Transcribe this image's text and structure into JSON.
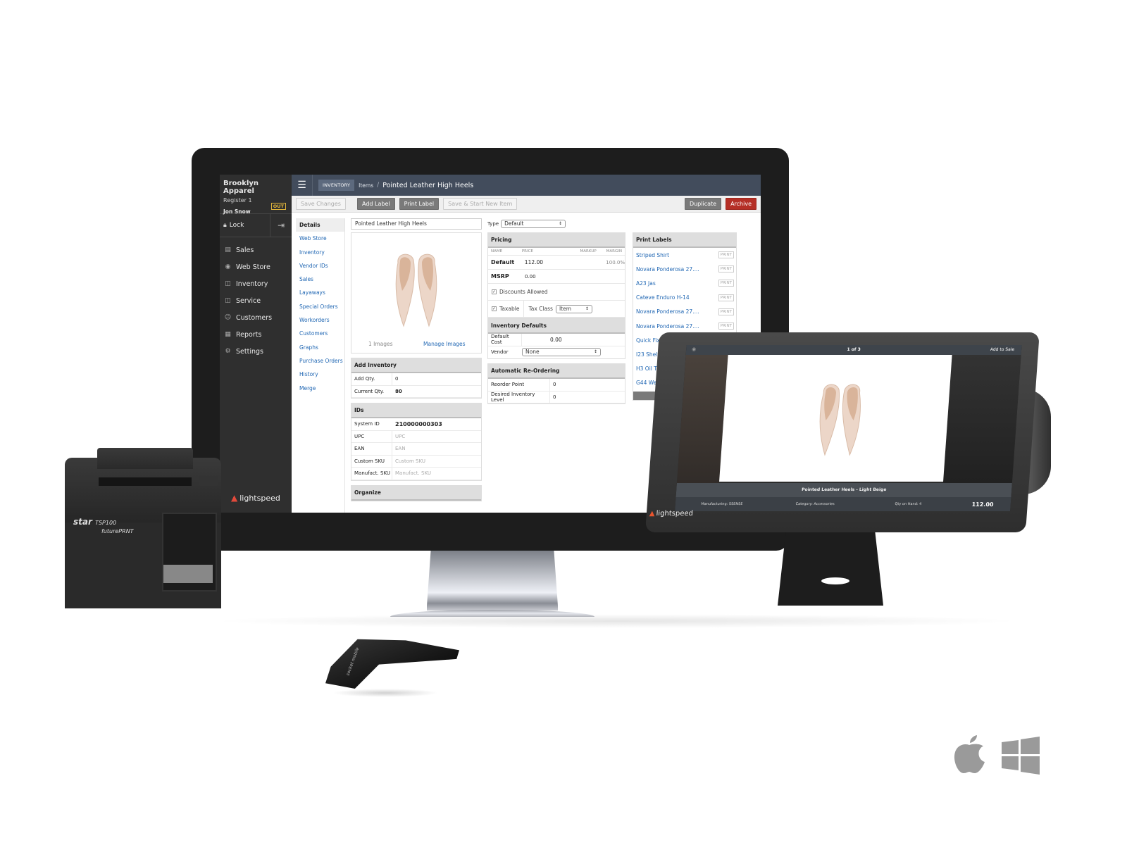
{
  "app": {
    "store_name": "Brooklyn Apparel",
    "register": "Register 1",
    "user": "Jon Snow",
    "status_badge": "OUT",
    "lock_label": "Lock",
    "brand": "lightspeed"
  },
  "nav": {
    "items": [
      {
        "label": "Sales",
        "icon": "cart-icon"
      },
      {
        "label": "Web Store",
        "icon": "globe-icon"
      },
      {
        "label": "Inventory",
        "icon": "box-icon"
      },
      {
        "label": "Service",
        "icon": "toolbox-icon"
      },
      {
        "label": "Customers",
        "icon": "person-icon"
      },
      {
        "label": "Reports",
        "icon": "report-icon"
      },
      {
        "label": "Settings",
        "icon": "gear-icon"
      }
    ]
  },
  "breadcrumb": {
    "section": "INVENTORY",
    "items": "Items",
    "separator": "/",
    "title": "Pointed Leather High Heels"
  },
  "toolbar": {
    "save_changes": "Save Changes",
    "add_label": "Add Label",
    "print_label": "Print Label",
    "save_start_new": "Save & Start New Item",
    "duplicate": "Duplicate",
    "archive": "Archive"
  },
  "subnav": {
    "items": [
      "Details",
      "Web Store",
      "Inventory",
      "Vendor IDs",
      "Sales",
      "Layaways",
      "Special Orders",
      "Workorders",
      "Customers",
      "Graphs",
      "Purchase Orders",
      "History",
      "Merge"
    ]
  },
  "item": {
    "name": "Pointed Leather High Heels",
    "images_count": "1 Images",
    "manage_images": "Manage Images",
    "type_label": "Type",
    "type_value": "Default"
  },
  "add_inventory": {
    "title": "Add Inventory",
    "add_qty_label": "Add Qty.",
    "add_qty_value": "0",
    "current_qty_label": "Current Qty.",
    "current_qty_value": "80"
  },
  "ids": {
    "title": "IDs",
    "system_id_label": "System ID",
    "system_id_value": "210000000303",
    "upc_label": "UPC",
    "upc_placeholder": "UPC",
    "ean_label": "EAN",
    "ean_placeholder": "EAN",
    "custom_sku_label": "Custom SKU",
    "custom_sku_placeholder": "Custom SKU",
    "manufact_sku_label": "Manufact. SKU",
    "manufact_sku_placeholder": "Manufact. SKU"
  },
  "organize": {
    "title": "Organize"
  },
  "pricing": {
    "title": "Pricing",
    "columns": [
      "NAME",
      "PRICE",
      "MARKUP",
      "MARGIN"
    ],
    "rows": [
      {
        "name": "Default",
        "price": "112.00",
        "margin": "100.0%"
      },
      {
        "name": "MSRP",
        "price": "0.00",
        "margin": ""
      }
    ],
    "discounts_allowed": "Discounts Allowed",
    "taxable": "Taxable",
    "tax_class_label": "Tax Class",
    "tax_class_value": "Item"
  },
  "inventory_defaults": {
    "title": "Inventory Defaults",
    "default_cost_label": "Default Cost",
    "default_cost_value": "0.00",
    "vendor_label": "Vendor",
    "vendor_value": "None"
  },
  "reordering": {
    "title": "Automatic Re-Ordering",
    "reorder_point_label": "Reorder Point",
    "reorder_point_value": "0",
    "desired_level_label": "Desired Inventory Level",
    "desired_level_value": "0"
  },
  "print_labels": {
    "title": "Print Labels",
    "button": "PRINT",
    "print_all": "Print",
    "items": [
      "Striped Shirt",
      "Novara Ponderosa 27....",
      "A23 Jas",
      "Cateve Enduro H-14",
      "Novara Ponderosa 27....",
      "Novara Ponderosa 27....",
      "Quick Fix Kit",
      "I23 Shelter W...",
      "H3 Oil Tin C...",
      "G44 Westla..."
    ]
  },
  "tablet": {
    "pager": "1 of 3",
    "add_to_sale": "Add to Sale",
    "product_title": "Pointed Leather Heels - Light Beige",
    "manufacturing": "Manufacturing: SSENSE",
    "category": "Category: Accessories",
    "qty_on_hand": "Qty on Hand: 4",
    "price": "112.00",
    "brand": "lightspeed"
  },
  "printer": {
    "brand": "star",
    "model": "TSP100",
    "sub": "futurePRNT"
  },
  "scanner": {
    "brand": "socket mobile"
  },
  "colors": {
    "topbar": "#424c5c",
    "link": "#1f66b3",
    "archive": "#b52f26",
    "nav_bg": "#2f2f2f",
    "out_badge": "#e0b43a"
  }
}
